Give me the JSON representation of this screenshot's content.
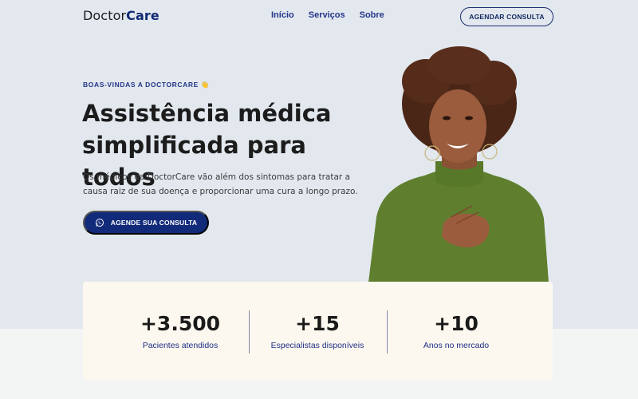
{
  "header": {
    "logo_light": "Doctor",
    "logo_bold": "Care",
    "nav": [
      {
        "label": "Início"
      },
      {
        "label": "Serviços"
      },
      {
        "label": "Sobre"
      }
    ],
    "cta_label": "AGENDAR CONSULTA"
  },
  "hero": {
    "eyebrow": "BOAS-VINDAS A DOCTORCARE 👋",
    "headline": "Assistência médica simplificada para todos",
    "lead": "Os médicos da DoctorCare vão além dos sintomas para tratar a causa raiz de sua doença e proporcionar uma cura a longo prazo.",
    "cta_label": "AGENDE SUA CONSULTA",
    "cta_icon": "whatsapp-icon"
  },
  "stats": [
    {
      "value": "+3.500",
      "label": "Pacientes atendidos"
    },
    {
      "value": "+15",
      "label": "Especialistas disponíveis"
    },
    {
      "value": "+10",
      "label": "Anos no mercado"
    }
  ],
  "colors": {
    "brand": "#122a7a",
    "background": "#e2e8ee",
    "card": "#fdf8ef",
    "sweater": "#5f7f2e"
  }
}
